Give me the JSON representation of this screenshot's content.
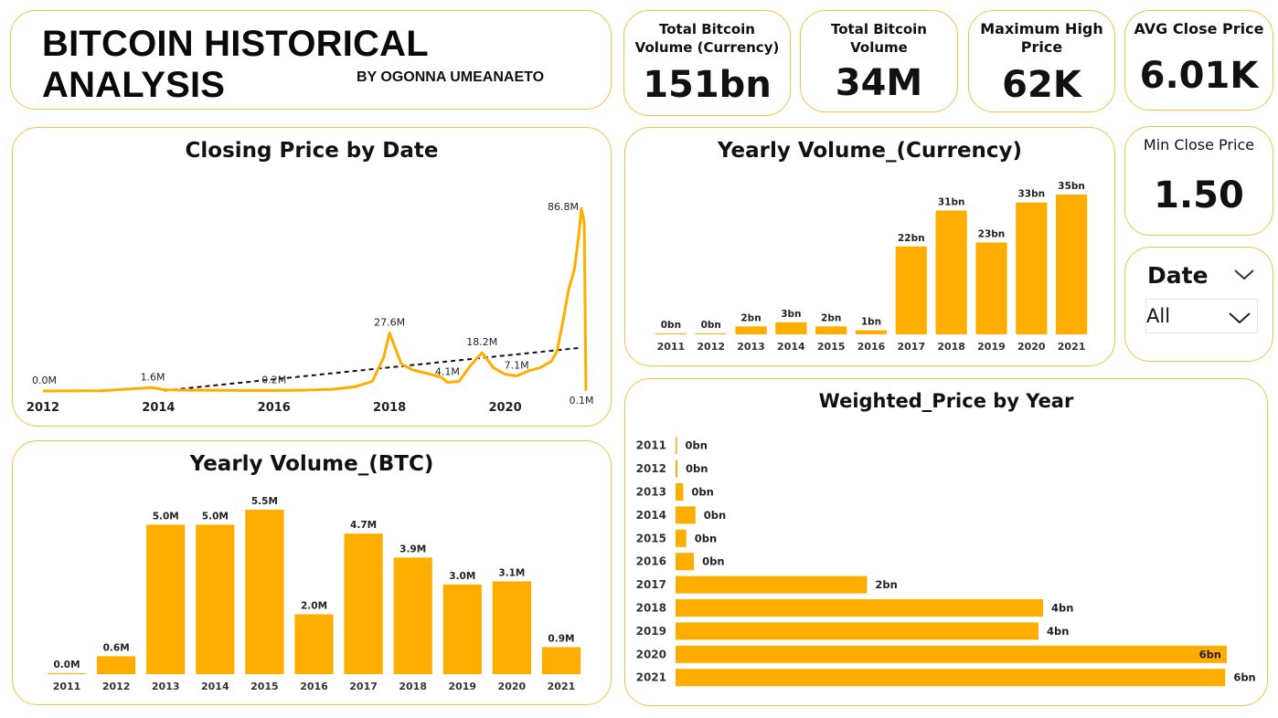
{
  "header": {
    "title": "BITCOIN HISTORICAL ANALYSIS",
    "subtitle": "BY OGONNA UMEANAETO"
  },
  "kpis": {
    "total_volume_currency": {
      "title_line1": "Total Bitcoin",
      "title_line2": "Volume (Currency)",
      "value": "151bn"
    },
    "total_volume": {
      "title_line1": "Total Bitcoin",
      "title_line2": "Volume",
      "value": "34M"
    },
    "max_high": {
      "title_line1": "Maximum High",
      "title_line2": "Price",
      "value": "62K"
    },
    "avg_close": {
      "title_line1": "AVG Close Price",
      "value": "6.01K"
    },
    "min_close": {
      "title_line1": "Min Close Price",
      "value": "1.50"
    }
  },
  "slicer": {
    "label": "Date",
    "selected": "All"
  },
  "colors": {
    "accent": "#FFAE00",
    "border": "#F0C34A",
    "trend": "#111111"
  },
  "chart_data": [
    {
      "id": "closing_price",
      "type": "line",
      "title": "Closing Price by Date",
      "x_ticks": [
        "2012",
        "2014",
        "2016",
        "2018",
        "2020"
      ],
      "trendline": true,
      "series": [
        {
          "x": [
            2012.0,
            2013.0,
            2013.9,
            2014.1,
            2014.5,
            2015.0,
            2015.5,
            2016.0,
            2016.5,
            2017.0,
            2017.4,
            2017.7,
            2017.9,
            2018.0,
            2018.2,
            2018.4,
            2018.7,
            2018.9,
            2019.0,
            2019.2,
            2019.4,
            2019.6,
            2019.8,
            2020.0,
            2020.2,
            2020.4,
            2020.6,
            2020.8,
            2020.9,
            2021.0,
            2021.1,
            2021.2,
            2021.28,
            2021.32,
            2021.37,
            2021.4
          ],
          "y": [
            0.0,
            0.1,
            1.6,
            0.6,
            0.4,
            0.3,
            0.2,
            0.2,
            0.4,
            0.8,
            2.0,
            4.5,
            16.0,
            27.6,
            13.0,
            10.0,
            8.0,
            6.5,
            4.1,
            4.5,
            12.0,
            18.2,
            11.0,
            8.0,
            7.1,
            9.5,
            11.0,
            14.0,
            19.0,
            33.0,
            48.0,
            58.0,
            75.0,
            86.8,
            80.0,
            0.1
          ]
        }
      ],
      "labels": [
        {
          "x": 2012.0,
          "y": 0.0,
          "text": "0.0M"
        },
        {
          "x": 2013.9,
          "y": 1.6,
          "text": "1.6M"
        },
        {
          "x": 2016.0,
          "y": 0.2,
          "text": "0.2M"
        },
        {
          "x": 2018.0,
          "y": 27.6,
          "text": "27.6M"
        },
        {
          "x": 2019.0,
          "y": 4.1,
          "text": "4.1M"
        },
        {
          "x": 2019.6,
          "y": 18.2,
          "text": "18.2M"
        },
        {
          "x": 2020.2,
          "y": 7.1,
          "text": "7.1M"
        },
        {
          "x": 2021.32,
          "y": 86.8,
          "text": "86.8M"
        },
        {
          "x": 2021.4,
          "y": 0.1,
          "text": "0.1M"
        }
      ]
    },
    {
      "id": "yearly_volume_currency",
      "type": "bar",
      "title": "Yearly Volume_(Currency)",
      "categories": [
        "2011",
        "2012",
        "2013",
        "2014",
        "2015",
        "2016",
        "2017",
        "2018",
        "2019",
        "2020",
        "2021"
      ],
      "values": [
        0.05,
        0.2,
        2,
        3,
        2,
        1,
        22,
        31,
        23,
        33,
        35
      ],
      "value_labels": [
        "0bn",
        "0bn",
        "2bn",
        "3bn",
        "2bn",
        "1bn",
        "22bn",
        "31bn",
        "23bn",
        "33bn",
        "35bn"
      ]
    },
    {
      "id": "yearly_volume_btc",
      "type": "bar",
      "title": "Yearly Volume_(BTC)",
      "categories": [
        "2011",
        "2012",
        "2013",
        "2014",
        "2015",
        "2016",
        "2017",
        "2018",
        "2019",
        "2020",
        "2021"
      ],
      "values": [
        0.01,
        0.6,
        5.0,
        5.0,
        5.5,
        2.0,
        4.7,
        3.9,
        3.0,
        3.1,
        0.9
      ],
      "value_labels": [
        "0.0M",
        "0.6M",
        "5.0M",
        "5.0M",
        "5.5M",
        "2.0M",
        "4.7M",
        "3.9M",
        "3.0M",
        "3.1M",
        "0.9M"
      ]
    },
    {
      "id": "weighted_price",
      "type": "bar",
      "orientation": "horizontal",
      "title": "Weighted_Price by Year",
      "categories": [
        "2011",
        "2012",
        "2013",
        "2014",
        "2015",
        "2016",
        "2017",
        "2018",
        "2019",
        "2020",
        "2021"
      ],
      "values": [
        0.004,
        0.012,
        0.05,
        0.13,
        0.07,
        0.12,
        1.25,
        2.4,
        2.37,
        3.6,
        3.59
      ],
      "value_labels": [
        "0bn",
        "0bn",
        "0bn",
        "0bn",
        "0bn",
        "0bn",
        "2bn",
        "4bn",
        "4bn",
        "6bn",
        "6bn"
      ],
      "inside_label_indices": [
        9
      ]
    }
  ]
}
